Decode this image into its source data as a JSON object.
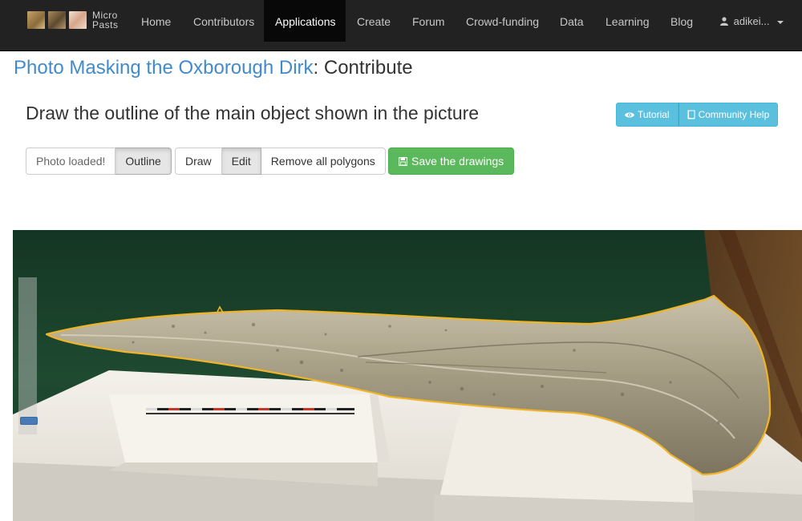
{
  "brand": {
    "line1": "Micro",
    "line2": "Pasts"
  },
  "nav": {
    "items": [
      "Home",
      "Contributors",
      "Applications",
      "Create",
      "Forum",
      "Crowd-funding",
      "Data",
      "Learning",
      "Blog"
    ],
    "active": "Applications",
    "user": "adikei..."
  },
  "page": {
    "title_link": "Photo Masking the Oxborough Dirk",
    "title_suffix": ": Contribute",
    "instruction": "Draw the outline of the main object shown in the picture"
  },
  "help": {
    "tutorial_label": "Tutorial",
    "community_label": "Community Help"
  },
  "toolbar": {
    "photo_status": "Photo loaded!",
    "outline_label": "Outline",
    "draw_label": "Draw",
    "edit_label": "Edit",
    "remove_label": "Remove all polygons",
    "save_label": "Save the drawings"
  },
  "colors": {
    "navbar": "#222222",
    "link": "#428bca",
    "info": "#5bc0de",
    "success": "#5cb85c",
    "outline": "#f0b429"
  },
  "icons": {
    "tutorial": "eye-icon",
    "community": "book-icon",
    "save": "floppy-disk-icon",
    "user": "user-icon",
    "caret": "caret-down-icon"
  }
}
